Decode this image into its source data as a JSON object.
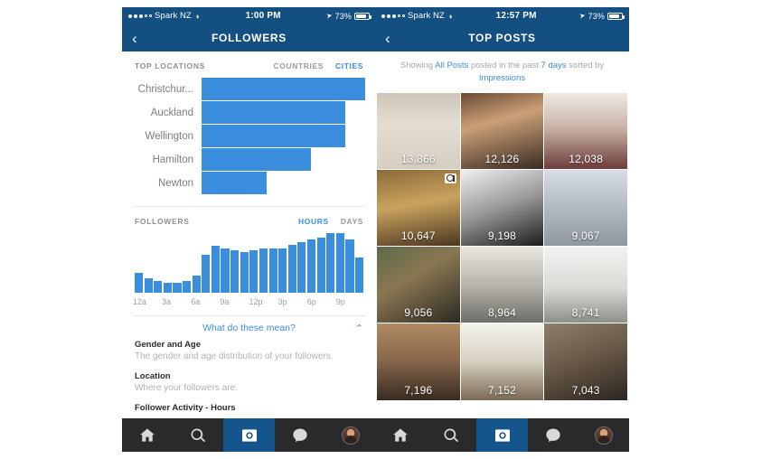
{
  "left": {
    "status": {
      "carrier": "Spark NZ",
      "time": "1:00 PM",
      "battery": "73%"
    },
    "nav": {
      "back": "‹",
      "title": "FOLLOWERS"
    },
    "locations": {
      "section_title": "TOP LOCATIONS",
      "segments": [
        {
          "label": "COUNTRIES",
          "active": false
        },
        {
          "label": "CITIES",
          "active": true
        }
      ]
    },
    "followers": {
      "section_title": "FOLLOWERS",
      "segments": [
        {
          "label": "HOURS",
          "active": true
        },
        {
          "label": "DAYS",
          "active": false
        }
      ]
    },
    "explain": {
      "link": "What do these mean?",
      "chevron": "⌃",
      "items": [
        {
          "title": "Gender and Age",
          "desc": "The gender and age distribution of your followers."
        },
        {
          "title": "Location",
          "desc": "Where your followers are."
        },
        {
          "title": "Follower Activity - Hours",
          "desc": ""
        }
      ]
    }
  },
  "right": {
    "status": {
      "carrier": "Spark NZ",
      "time": "12:57 PM",
      "battery": "73%"
    },
    "nav": {
      "back": "‹",
      "title": "TOP POSTS"
    },
    "showing": {
      "prefix": "Showing ",
      "filter": "All Posts",
      "middle": " posted in the past ",
      "range": "7 days",
      "suffix": " sorted by ",
      "sort": "Impressions"
    },
    "posts": [
      {
        "count": "13,866",
        "badge": ""
      },
      {
        "count": "12,126",
        "badge": ""
      },
      {
        "count": "12,038",
        "badge": ""
      },
      {
        "count": "10,647",
        "badge": "carousel"
      },
      {
        "count": "9,198",
        "badge": ""
      },
      {
        "count": "9,067",
        "badge": ""
      },
      {
        "count": "9,056",
        "badge": ""
      },
      {
        "count": "8,964",
        "badge": ""
      },
      {
        "count": "8,741",
        "badge": ""
      },
      {
        "count": "7,196",
        "badge": ""
      },
      {
        "count": "7,152",
        "badge": ""
      },
      {
        "count": "7,043",
        "badge": ""
      }
    ]
  },
  "tabbar": {
    "items": [
      {
        "icon": "home-icon",
        "active": false
      },
      {
        "icon": "search-icon",
        "active": false
      },
      {
        "icon": "camera-icon",
        "active": true
      },
      {
        "icon": "activity-icon",
        "active": false
      },
      {
        "icon": "profile-avatar",
        "active": false
      }
    ]
  },
  "colors": {
    "header_navy": "#134f81",
    "accent_blue": "#3b8ddd",
    "tabbar_bg": "#2a2a2c",
    "tab_active": "#14558c"
  },
  "chart_data": [
    {
      "type": "bar",
      "title": "TOP LOCATIONS",
      "orientation": "horizontal",
      "categories": [
        "Christchur...",
        "Auckland",
        "Wellington",
        "Hamilton",
        "Newton"
      ],
      "values": [
        100,
        88,
        88,
        67,
        40
      ],
      "ylim": [
        0,
        100
      ],
      "xlabel": "",
      "ylabel": "",
      "grid": false,
      "legend": "none"
    },
    {
      "type": "bar",
      "title": "FOLLOWERS",
      "orientation": "vertical",
      "categories": [
        "12a",
        "1a",
        "2a",
        "3a",
        "4a",
        "5a",
        "6a",
        "7a",
        "8a",
        "9a",
        "10a",
        "11a",
        "12p",
        "1p",
        "2p",
        "3p",
        "4p",
        "5p",
        "6p",
        "7p",
        "8p",
        "9p",
        "10p",
        "11p"
      ],
      "tick_labels": [
        "12a",
        "3a",
        "6a",
        "9a",
        "12p",
        "3p",
        "6p",
        "9p"
      ],
      "values": [
        30,
        22,
        17,
        15,
        15,
        18,
        26,
        56,
        70,
        66,
        64,
        61,
        63,
        66,
        66,
        66,
        71,
        76,
        80,
        82,
        89,
        89,
        80,
        52
      ],
      "ylim": [
        0,
        100
      ],
      "xlabel": "",
      "ylabel": "",
      "grid": false,
      "legend": "none"
    },
    {
      "type": "table",
      "title": "TOP POSTS",
      "metric": "Impressions",
      "values": [
        13866,
        12126,
        12038,
        10647,
        9198,
        9067,
        9056,
        8964,
        8741,
        7196,
        7152,
        7043
      ]
    }
  ]
}
